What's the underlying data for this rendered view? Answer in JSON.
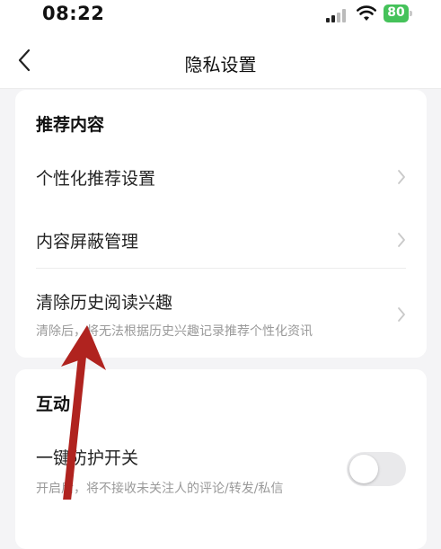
{
  "status_bar": {
    "time": "08:22",
    "battery_level": "80"
  },
  "header": {
    "title": "隐私设置",
    "back_icon": "chevron-left-icon"
  },
  "sections": [
    {
      "title": "推荐内容",
      "rows": [
        {
          "label": "个性化推荐设置",
          "icon": "chevron-right-icon"
        },
        {
          "label": "内容屏蔽管理",
          "icon": "chevron-right-icon"
        },
        {
          "label": "清除历史阅读兴趣",
          "description": "清除后，将无法根据历史兴趣记录推荐个性化资讯",
          "icon": "chevron-right-icon"
        }
      ]
    },
    {
      "title": "互动",
      "rows": [
        {
          "label": "一键防护开关",
          "description": "开启后，将不接收未关注人的评论/转发/私信",
          "toggle_on": false
        }
      ]
    }
  ],
  "colors": {
    "annotation_arrow": "#b0231f",
    "battery": "#45c25a",
    "chevron": "#c9c9c9"
  }
}
